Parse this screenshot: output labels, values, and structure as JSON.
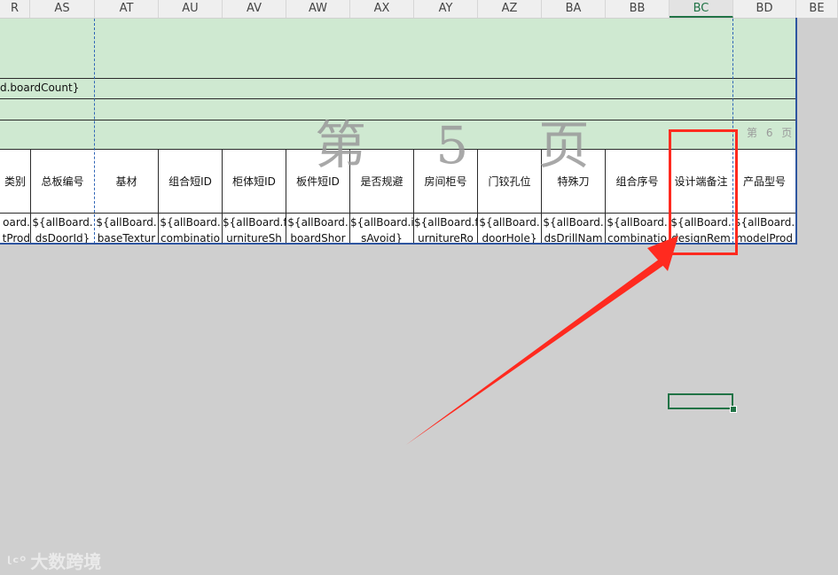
{
  "columns": [
    {
      "id": "R",
      "selected": false
    },
    {
      "id": "AS",
      "selected": false
    },
    {
      "id": "AT",
      "selected": false
    },
    {
      "id": "AU",
      "selected": false
    },
    {
      "id": "AV",
      "selected": false
    },
    {
      "id": "AW",
      "selected": false
    },
    {
      "id": "AX",
      "selected": false
    },
    {
      "id": "AY",
      "selected": false
    },
    {
      "id": "AZ",
      "selected": false
    },
    {
      "id": "BA",
      "selected": false
    },
    {
      "id": "BB",
      "selected": false
    },
    {
      "id": "BC",
      "selected": true
    },
    {
      "id": "BD",
      "selected": false
    },
    {
      "id": "BE",
      "selected": false
    }
  ],
  "row_board_count": "d.boardCount}",
  "watermark": {
    "big": "第 5 页",
    "small": "第 6 页"
  },
  "headers": [
    "类别",
    "总板编号",
    "基材",
    "组合短ID",
    "柜体短ID",
    "板件短ID",
    "是否规避",
    "房间柜号",
    "门铰孔位",
    "特殊刀",
    "组合序号",
    "设计端备注",
    "产品型号"
  ],
  "templates": [
    [
      "oard.",
      "tProd"
    ],
    [
      "${allBoard.",
      "dsDoorId}"
    ],
    [
      "${allBoard.",
      "baseTextur"
    ],
    [
      "${allBoard.",
      "combinatio"
    ],
    [
      "${allBoard.f",
      "urnitureSh"
    ],
    [
      "${allBoard.",
      "boardShor"
    ],
    [
      "${allBoard.i",
      "sAvoid}"
    ],
    [
      "${allBoard.f",
      "urnitureRo"
    ],
    [
      "${allBoard.",
      "doorHole}"
    ],
    [
      "${allBoard.",
      "dsDrillNam"
    ],
    [
      "${allBoard.",
      "combinatio"
    ],
    [
      "${allBoard.",
      "designRem"
    ],
    [
      "${allBoard.",
      "modelProd"
    ]
  ],
  "logo_text": "大数跨境",
  "colors": {
    "accent_green": "#217346",
    "band_green": "#cfe9d1",
    "annotation_red": "#ff2a1f",
    "page_break_blue": "#2e64b6"
  }
}
